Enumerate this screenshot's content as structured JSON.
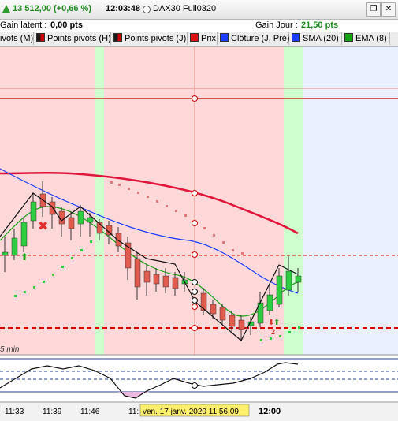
{
  "header": {
    "price": "13 512,00 (+0,66 %)",
    "time": "12:03:48",
    "instrument": "DAX30 Full0320",
    "restore_icon": "restore-icon",
    "close_icon": "close-icon"
  },
  "gains": {
    "latent_label": "Gain latent :",
    "latent_value": "0,00 pts",
    "day_label": "Gain Jour :",
    "day_value": "21,50 pts"
  },
  "legend": [
    {
      "label": "ivots (M)",
      "swatch": "blk"
    },
    {
      "label": "Points pivots (H)",
      "swatch": "blk"
    },
    {
      "label": "Points pivots (J)",
      "swatch": "blk"
    },
    {
      "label": "Prix",
      "swatch": "red"
    },
    {
      "label": "Clôture (J, Pré)",
      "swatch": "blue"
    },
    {
      "label": "SMA (20)",
      "swatch": "blue"
    },
    {
      "label": "EMA (8)",
      "swatch": "green"
    }
  ],
  "chart": {
    "timeframe_label": "5 min",
    "crosshair_label": "ven. 17 janv. 2020 11:56:09",
    "time_ticks": [
      "11:33",
      "11:39",
      "11:46",
      "11:",
      "12:00"
    ],
    "colors": {
      "up": "#2ecc40",
      "down": "#e05a4e",
      "sma": "#1a3cff",
      "ema": "#16a316",
      "ma200": "#e0143c",
      "bg_red": "#ffd9d9",
      "bg_green": "#cfffcf",
      "bg_blue": "#eaf0ff"
    }
  }
}
